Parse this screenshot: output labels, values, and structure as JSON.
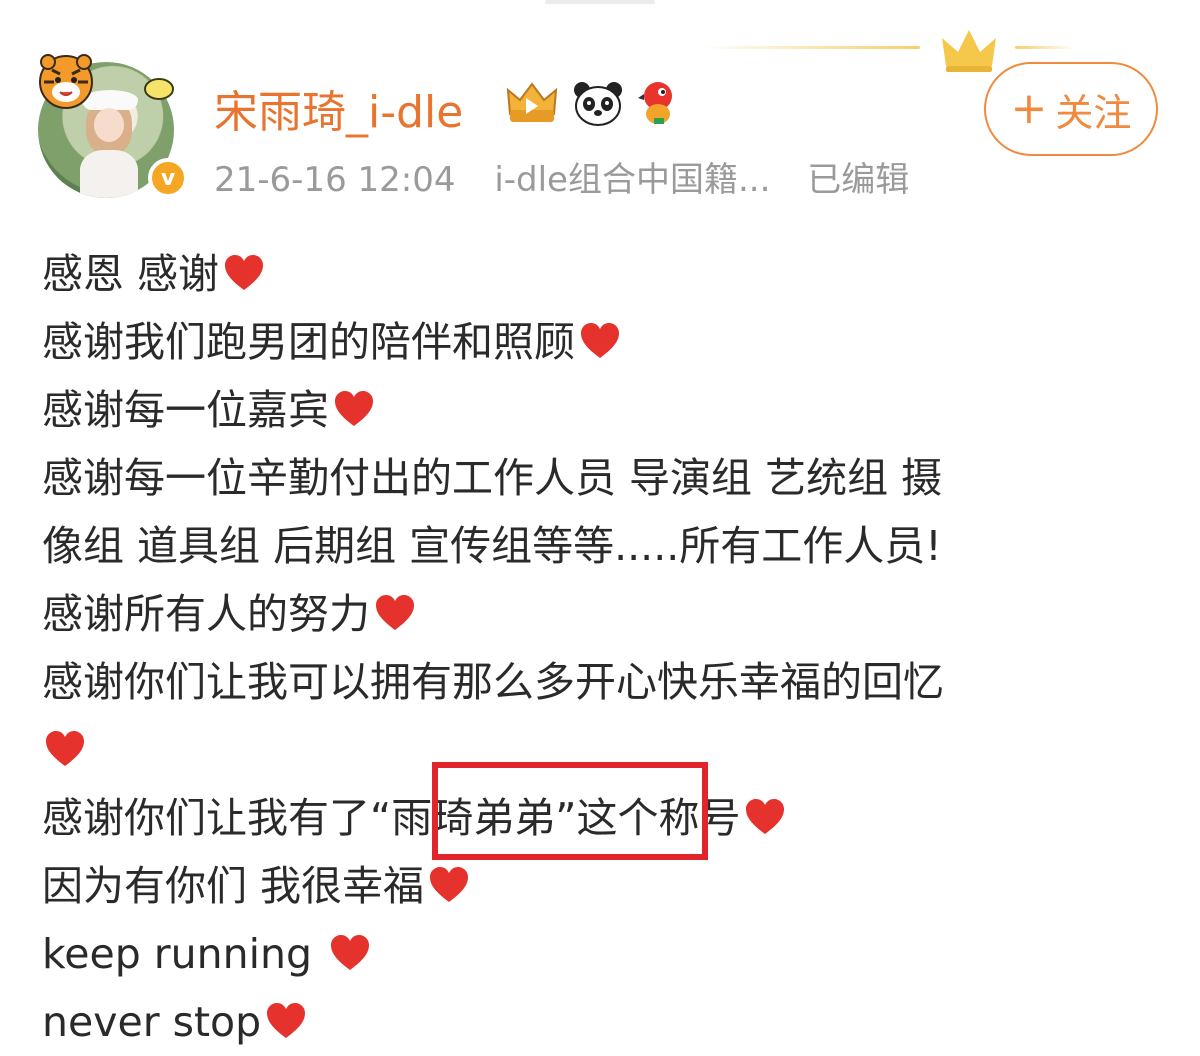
{
  "user": {
    "name": "宋雨琦_i-dle",
    "avatar_icon": "user-avatar-photo",
    "verified_badge": "v"
  },
  "meta": {
    "timestamp": "21-6-16 12:04",
    "source": "i-dle组合中国籍...",
    "edited": "已编辑"
  },
  "follow": {
    "plus": "+",
    "label": "关注"
  },
  "post": {
    "lines": [
      "感恩 感谢",
      "感谢我们跑男团的陪伴和照顾",
      "感谢每一位嘉宾",
      "感谢每一位辛勤付出的工作人员 导演组 艺统组 摄",
      "像组 道具组 后期组 宣传组等等.....所有工作人员!",
      "感谢所有人的努力",
      "感谢你们让我可以拥有那么多开心快乐幸福的回忆",
      "",
      "感谢你们让我有了“雨琦弟弟”这个称号",
      "因为有你们 我很幸福",
      "keep running ",
      "never stop"
    ]
  },
  "colors": {
    "accent": "#e8742f",
    "follow": "#ef8a3f",
    "meta": "#9a9a9a",
    "heart": "#e5322d",
    "highlight": "#e0262b"
  }
}
